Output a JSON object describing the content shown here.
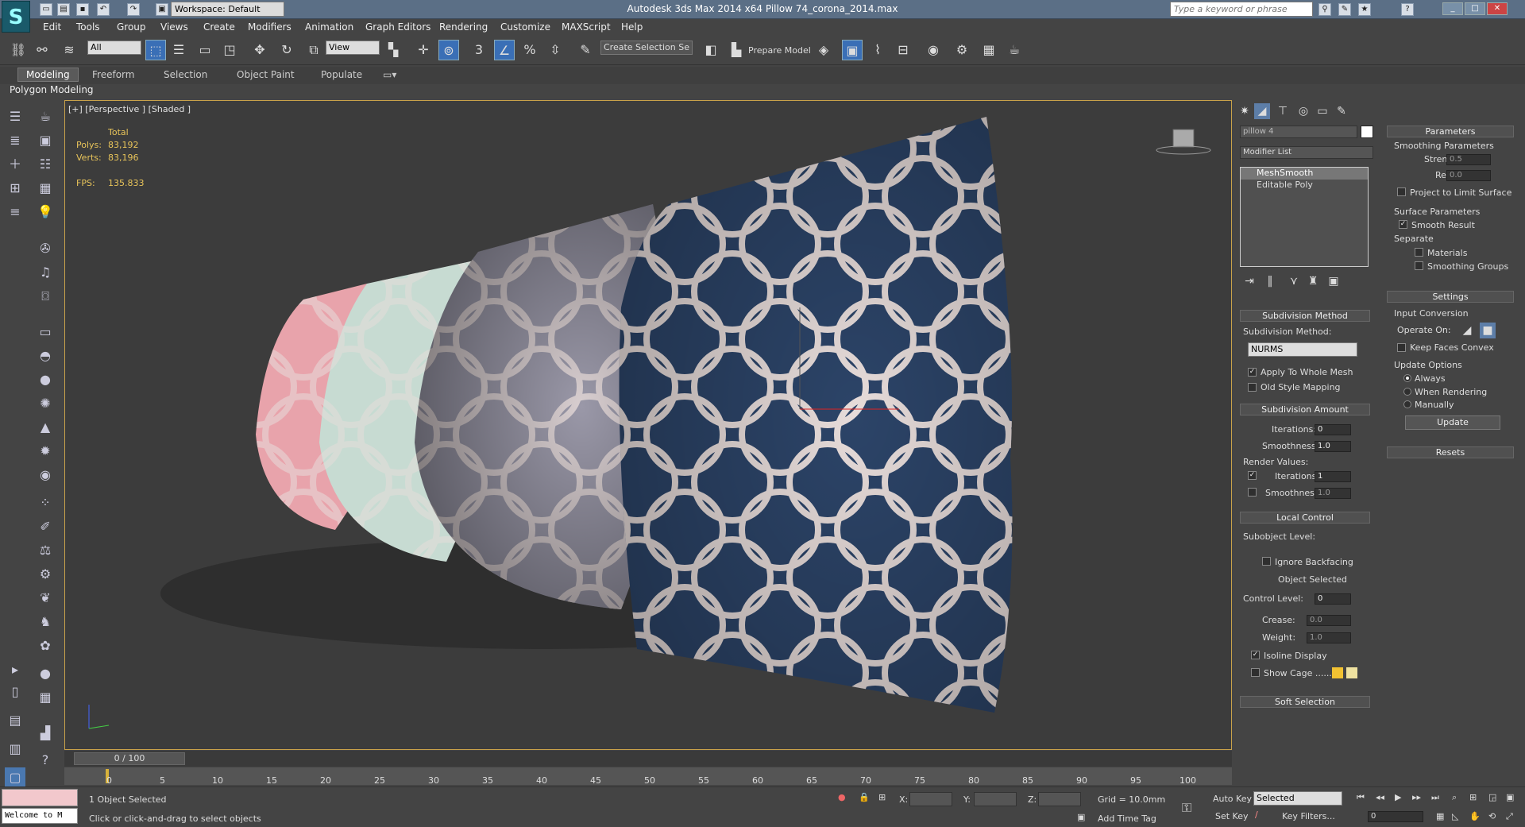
{
  "app": {
    "title": "Autodesk 3ds Max  2014 x64     Pillow 74_corona_2014.max",
    "workspace": "Workspace: Default",
    "search_placeholder": "Type a keyword or phrase"
  },
  "menu": [
    "Edit",
    "Tools",
    "Group",
    "Views",
    "Create",
    "Modifiers",
    "Animation",
    "Graph Editors",
    "Rendering",
    "Customize",
    "MAXScript",
    "Help"
  ],
  "toolbar": {
    "selection_filter": "All",
    "ref_coord": "View",
    "named_selection": "Create Selection Se",
    "prepare_model": "Prepare Model"
  },
  "ribbon": {
    "tabs": [
      "Modeling",
      "Freeform",
      "Selection",
      "Object Paint",
      "Populate"
    ],
    "subtitle": "Polygon Modeling"
  },
  "viewport": {
    "label": "[+] [Perspective ] [Shaded ]",
    "stats": {
      "total_label": "Total",
      "polys_label": "Polys:",
      "polys_value": "83,192",
      "verts_label": "Verts:",
      "verts_value": "83,196",
      "fps_label": "FPS:",
      "fps_value": "135.833"
    },
    "colors": {
      "pillow_pink": "#e8a3ab",
      "pillow_mint": "#c7dbd2",
      "pillow_lavender": "#9a98a8",
      "pillow_navy": "#2c4468",
      "pattern": "#e7dcda",
      "viewport_bg": "#3c3c3c"
    }
  },
  "command_panel": {
    "object_name": "pillow 4",
    "modifier_list": "Modifier List",
    "stack": [
      "MeshSmooth",
      "Editable Poly"
    ],
    "subdivision_method": {
      "header": "Subdivision Method",
      "label": "Subdivision Method:",
      "value": "NURMS",
      "apply_whole_mesh": "Apply To Whole Mesh",
      "old_style_mapping": "Old Style Mapping"
    },
    "subdivision_amount": {
      "header": "Subdivision Amount",
      "iterations_label": "Iterations:",
      "iterations_value": "0",
      "smoothness_label": "Smoothness:",
      "smoothness_value": "1.0",
      "render_values": "Render Values:",
      "r_iterations_label": "Iterations:",
      "r_iterations_value": "1",
      "r_smoothness_label": "Smoothness:",
      "r_smoothness_value": "1.0"
    },
    "local_control": {
      "header": "Local Control",
      "subobject_level": "Subobject Level:",
      "ignore_backfacing": "Ignore Backfacing",
      "object_selected": "Object Selected",
      "control_level_label": "Control Level:",
      "control_level_value": "0",
      "crease_label": "Crease:",
      "crease_value": "0.0",
      "weight_label": "Weight:",
      "weight_value": "1.0",
      "isoline_display": "Isoline Display",
      "show_cage": "Show Cage ......"
    },
    "soft_selection": "Soft Selection",
    "parameters": {
      "header": "Parameters",
      "smoothing_parameters": "Smoothing Parameters",
      "strength_label": "Strength:",
      "strength_value": "0.5",
      "relax_label": "Relax:",
      "relax_value": "0.0",
      "project_limit": "Project to Limit Surface",
      "surface_parameters": "Surface Parameters",
      "smooth_result": "Smooth Result",
      "separate": "Separate",
      "materials": "Materials",
      "smoothing_groups": "Smoothing Groups"
    },
    "settings": {
      "header": "Settings",
      "input_conversion": "Input Conversion",
      "operate_on": "Operate On:",
      "keep_faces_convex": "Keep Faces Convex",
      "update_options": "Update Options",
      "always": "Always",
      "when_rendering": "When Rendering",
      "manually": "Manually",
      "update_button": "Update"
    },
    "resets": "Resets"
  },
  "timeline": {
    "frame": "0 / 100",
    "ticks": [
      "0",
      "5",
      "10",
      "15",
      "20",
      "25",
      "30",
      "35",
      "40",
      "45",
      "50",
      "55",
      "60",
      "65",
      "70",
      "75",
      "80",
      "85",
      "90",
      "95",
      "100"
    ]
  },
  "status": {
    "maxscript": "Welcome to M",
    "selected": "1 Object Selected",
    "prompt": "Click or click-and-drag to select objects",
    "x_label": "X:",
    "y_label": "Y:",
    "z_label": "Z:",
    "grid": "Grid = 10.0mm",
    "add_time_tag": "Add Time Tag",
    "auto_key": "Auto Key",
    "set_key": "Set Key",
    "selected_combo": "Selected",
    "key_filters": "Key Filters...",
    "frame_value": "0"
  }
}
